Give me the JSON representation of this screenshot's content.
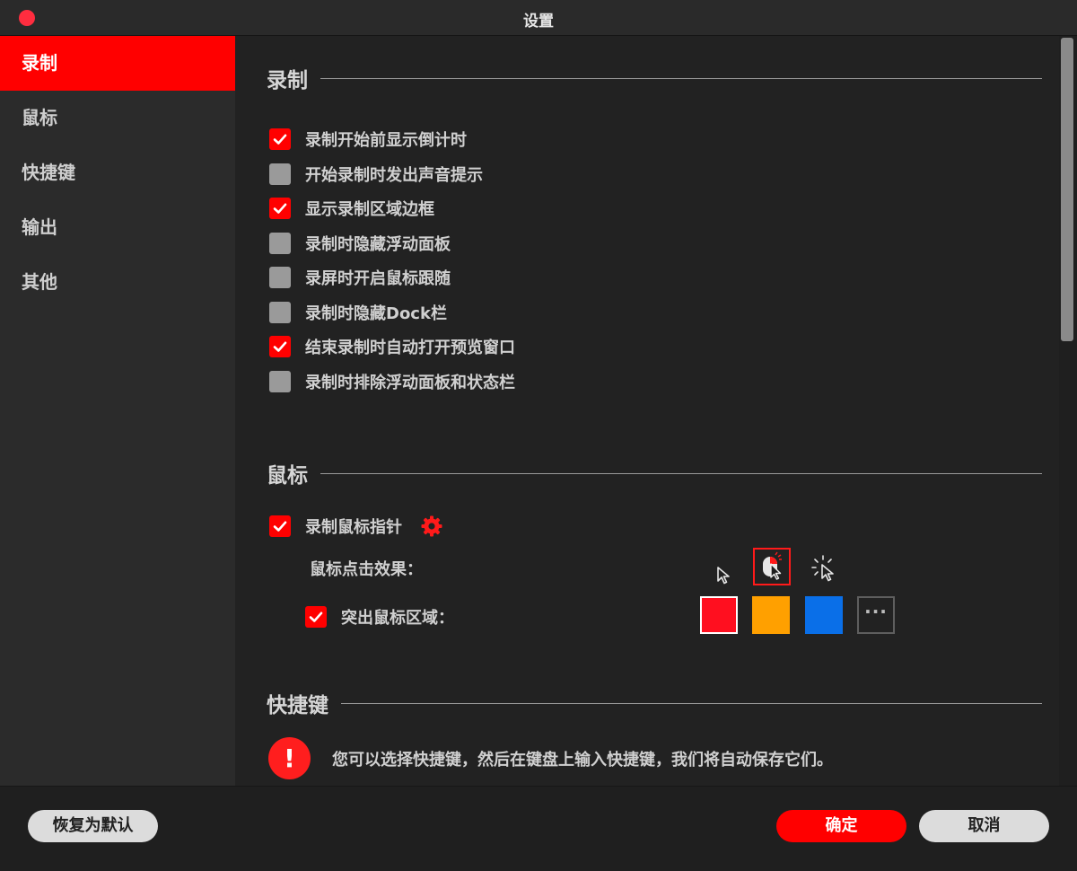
{
  "window": {
    "title": "设置"
  },
  "sidebar": {
    "items": [
      {
        "label": "录制",
        "active": true
      },
      {
        "label": "鼠标"
      },
      {
        "label": "快捷键"
      },
      {
        "label": "输出"
      },
      {
        "label": "其他"
      }
    ]
  },
  "recording": {
    "title": "录制",
    "options": [
      {
        "label": "录制开始前显示倒计时",
        "checked": true
      },
      {
        "label": "开始录制时发出声音提示",
        "checked": false
      },
      {
        "label": "显示录制区域边框",
        "checked": true
      },
      {
        "label": "录制时隐藏浮动面板",
        "checked": false
      },
      {
        "label": "录屏时开启鼠标跟随",
        "checked": false
      },
      {
        "label": "录制时隐藏Dock栏",
        "checked": false
      },
      {
        "label": "结束录制时自动打开预览窗口",
        "checked": true
      },
      {
        "label": "录制时排除浮动面板和状态栏",
        "checked": false
      }
    ]
  },
  "mouse": {
    "title": "鼠标",
    "record_pointer": {
      "label": "录制鼠标指针",
      "checked": true
    },
    "click_effect_label": "鼠标点击效果：",
    "click_effects": [
      "plain-cursor-icon",
      "click-highlight-cursor-icon",
      "click-burst-cursor-icon"
    ],
    "selected_click_effect": 1,
    "highlight": {
      "label": "突出鼠标区域：",
      "checked": true
    },
    "highlight_colors": [
      "#ff0f1f",
      "#ffa000",
      "#0a6fe8"
    ],
    "more_colors_label": "···"
  },
  "shortcuts": {
    "title": "快捷键",
    "info": "您可以选择快捷键，然后在键盘上输入快捷键，我们将自动保存它们。"
  },
  "footer": {
    "restore_label": "恢复为默认",
    "ok_label": "确定",
    "cancel_label": "取消"
  }
}
